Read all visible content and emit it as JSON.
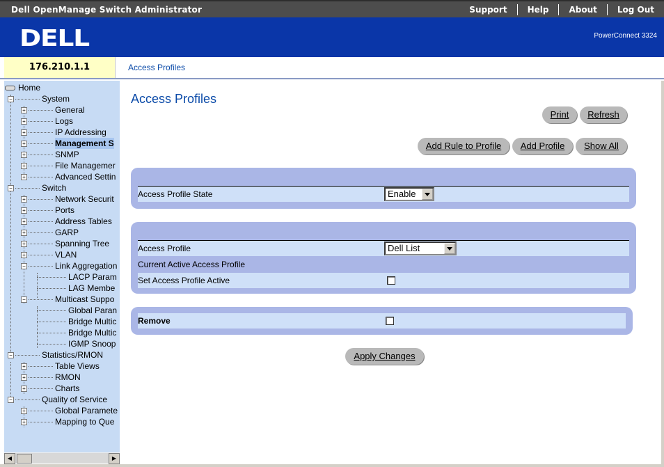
{
  "app": {
    "title": "Dell OpenManage Switch Administrator",
    "nav": [
      "Support",
      "Help",
      "About",
      "Log Out"
    ]
  },
  "banner": {
    "logo_text": "DELL",
    "model": "PowerConnect 3324"
  },
  "header": {
    "ip": "176.210.1.1",
    "breadcrumb": "Access Profiles"
  },
  "sidebar": {
    "items": [
      {
        "label": "Home"
      },
      {
        "label": "System"
      },
      {
        "label": "General"
      },
      {
        "label": "Logs"
      },
      {
        "label": "IP Addressing"
      },
      {
        "label": "Management S"
      },
      {
        "label": "SNMP"
      },
      {
        "label": "File Managemer"
      },
      {
        "label": "Advanced Settin"
      },
      {
        "label": "Switch"
      },
      {
        "label": "Network Securit"
      },
      {
        "label": "Ports"
      },
      {
        "label": "Address Tables"
      },
      {
        "label": "GARP"
      },
      {
        "label": "Spanning Tree"
      },
      {
        "label": "VLAN"
      },
      {
        "label": "Link Aggregation"
      },
      {
        "label": "LACP Param"
      },
      {
        "label": "LAG Membe"
      },
      {
        "label": "Multicast Suppo"
      },
      {
        "label": "Global Paran"
      },
      {
        "label": "Bridge Multic"
      },
      {
        "label": "Bridge Multic"
      },
      {
        "label": "IGMP Snoop"
      },
      {
        "label": "Statistics/RMON"
      },
      {
        "label": "Table Views"
      },
      {
        "label": "RMON"
      },
      {
        "label": "Charts"
      },
      {
        "label": "Quality of Service"
      },
      {
        "label": "Global Paramete"
      },
      {
        "label": "Mapping to Que"
      }
    ]
  },
  "main": {
    "title": "Access Profiles",
    "buttons": {
      "print": "Print",
      "refresh": "Refresh",
      "add_rule": "Add Rule to Profile",
      "add_profile": "Add Profile",
      "show_all": "Show All",
      "apply": "Apply Changes"
    },
    "state_panel": {
      "label": "Access Profile State",
      "value": "Enable"
    },
    "profile_panel": {
      "profile_label": "Access Profile",
      "profile_value": "Dell List",
      "current_label": "Current Active Access Profile",
      "set_active_label": "Set Access Profile Active",
      "set_active_checked": false
    },
    "remove_panel": {
      "label": "Remove",
      "checked": false
    }
  }
}
